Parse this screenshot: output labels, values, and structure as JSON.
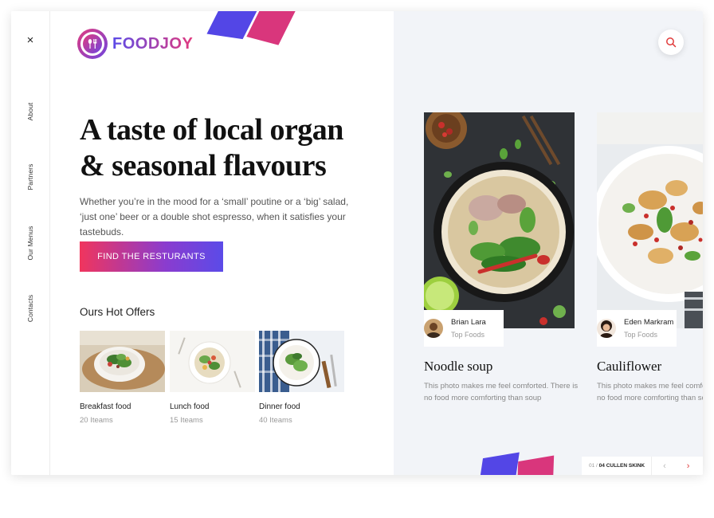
{
  "nav": {
    "close": "×",
    "items": [
      "About",
      "Partners",
      "Our Menus",
      "Contacts"
    ]
  },
  "brand": {
    "name": "FOODJOY"
  },
  "hero": {
    "title_line1": "A taste of local organ",
    "title_line2": "& seasonal flavours",
    "description": "Whether you’re in the mood for a ‘small’ poutine or a ‘big’ salad, ‘just one’ beer or a double shot espresso, when it satisfies your tastebuds.",
    "cta_label": "FIND THE RESTURANTS"
  },
  "offers": {
    "title": "Ours Hot Offers",
    "items": [
      {
        "name": "Breakfast food",
        "count": "20 Iteams"
      },
      {
        "name": "Lunch food",
        "count": "15 Iteams"
      },
      {
        "name": "Dinner food",
        "count": "40 Iteams"
      }
    ]
  },
  "cards": [
    {
      "author": "Brian Lara",
      "role": "Top Foods",
      "title": "Noodle soup",
      "description": "This photo makes me feel comforted. There is no food more comforting than soup"
    },
    {
      "author": "Eden Markram",
      "role": "Top Foods",
      "title": "Cauliflower",
      "description": "This photo makes me feel comforted. There is no food more comforting than soup"
    }
  ],
  "pager": {
    "current": "01",
    "separator": " / ",
    "total": "04",
    "label": "CULLEN SKINK",
    "prev": "‹",
    "next": "›"
  },
  "colors": {
    "accent_red": "#f0355d",
    "accent_purple": "#5b4be8",
    "accent_pink": "#e23a7e",
    "panel_bg": "#f2f4f8"
  }
}
